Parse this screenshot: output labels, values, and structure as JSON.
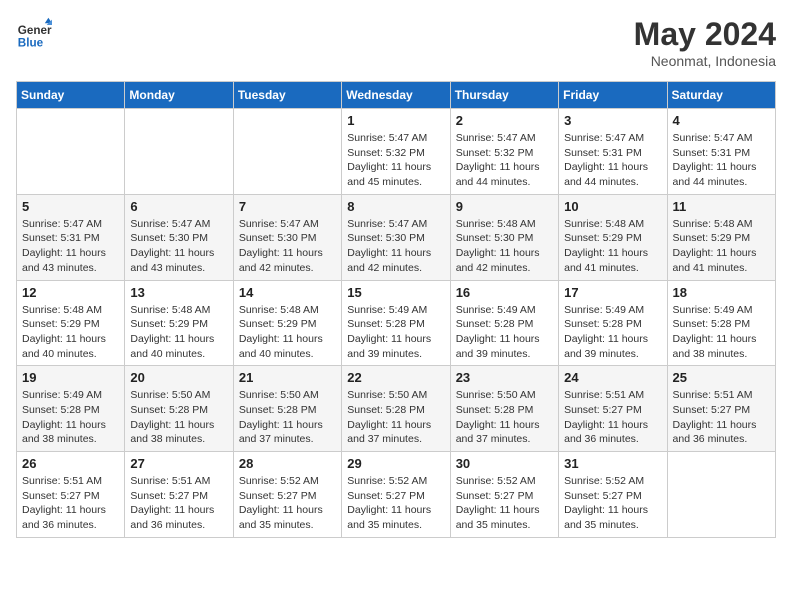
{
  "header": {
    "logo_line1": "General",
    "logo_line2": "Blue",
    "month": "May 2024",
    "location": "Neonmat, Indonesia"
  },
  "weekdays": [
    "Sunday",
    "Monday",
    "Tuesday",
    "Wednesday",
    "Thursday",
    "Friday",
    "Saturday"
  ],
  "weeks": [
    [
      {
        "day": "",
        "sunrise": "",
        "sunset": "",
        "daylight": ""
      },
      {
        "day": "",
        "sunrise": "",
        "sunset": "",
        "daylight": ""
      },
      {
        "day": "",
        "sunrise": "",
        "sunset": "",
        "daylight": ""
      },
      {
        "day": "1",
        "sunrise": "Sunrise: 5:47 AM",
        "sunset": "Sunset: 5:32 PM",
        "daylight": "Daylight: 11 hours and 45 minutes."
      },
      {
        "day": "2",
        "sunrise": "Sunrise: 5:47 AM",
        "sunset": "Sunset: 5:32 PM",
        "daylight": "Daylight: 11 hours and 44 minutes."
      },
      {
        "day": "3",
        "sunrise": "Sunrise: 5:47 AM",
        "sunset": "Sunset: 5:31 PM",
        "daylight": "Daylight: 11 hours and 44 minutes."
      },
      {
        "day": "4",
        "sunrise": "Sunrise: 5:47 AM",
        "sunset": "Sunset: 5:31 PM",
        "daylight": "Daylight: 11 hours and 44 minutes."
      }
    ],
    [
      {
        "day": "5",
        "sunrise": "Sunrise: 5:47 AM",
        "sunset": "Sunset: 5:31 PM",
        "daylight": "Daylight: 11 hours and 43 minutes."
      },
      {
        "day": "6",
        "sunrise": "Sunrise: 5:47 AM",
        "sunset": "Sunset: 5:30 PM",
        "daylight": "Daylight: 11 hours and 43 minutes."
      },
      {
        "day": "7",
        "sunrise": "Sunrise: 5:47 AM",
        "sunset": "Sunset: 5:30 PM",
        "daylight": "Daylight: 11 hours and 42 minutes."
      },
      {
        "day": "8",
        "sunrise": "Sunrise: 5:47 AM",
        "sunset": "Sunset: 5:30 PM",
        "daylight": "Daylight: 11 hours and 42 minutes."
      },
      {
        "day": "9",
        "sunrise": "Sunrise: 5:48 AM",
        "sunset": "Sunset: 5:30 PM",
        "daylight": "Daylight: 11 hours and 42 minutes."
      },
      {
        "day": "10",
        "sunrise": "Sunrise: 5:48 AM",
        "sunset": "Sunset: 5:29 PM",
        "daylight": "Daylight: 11 hours and 41 minutes."
      },
      {
        "day": "11",
        "sunrise": "Sunrise: 5:48 AM",
        "sunset": "Sunset: 5:29 PM",
        "daylight": "Daylight: 11 hours and 41 minutes."
      }
    ],
    [
      {
        "day": "12",
        "sunrise": "Sunrise: 5:48 AM",
        "sunset": "Sunset: 5:29 PM",
        "daylight": "Daylight: 11 hours and 40 minutes."
      },
      {
        "day": "13",
        "sunrise": "Sunrise: 5:48 AM",
        "sunset": "Sunset: 5:29 PM",
        "daylight": "Daylight: 11 hours and 40 minutes."
      },
      {
        "day": "14",
        "sunrise": "Sunrise: 5:48 AM",
        "sunset": "Sunset: 5:29 PM",
        "daylight": "Daylight: 11 hours and 40 minutes."
      },
      {
        "day": "15",
        "sunrise": "Sunrise: 5:49 AM",
        "sunset": "Sunset: 5:28 PM",
        "daylight": "Daylight: 11 hours and 39 minutes."
      },
      {
        "day": "16",
        "sunrise": "Sunrise: 5:49 AM",
        "sunset": "Sunset: 5:28 PM",
        "daylight": "Daylight: 11 hours and 39 minutes."
      },
      {
        "day": "17",
        "sunrise": "Sunrise: 5:49 AM",
        "sunset": "Sunset: 5:28 PM",
        "daylight": "Daylight: 11 hours and 39 minutes."
      },
      {
        "day": "18",
        "sunrise": "Sunrise: 5:49 AM",
        "sunset": "Sunset: 5:28 PM",
        "daylight": "Daylight: 11 hours and 38 minutes."
      }
    ],
    [
      {
        "day": "19",
        "sunrise": "Sunrise: 5:49 AM",
        "sunset": "Sunset: 5:28 PM",
        "daylight": "Daylight: 11 hours and 38 minutes."
      },
      {
        "day": "20",
        "sunrise": "Sunrise: 5:50 AM",
        "sunset": "Sunset: 5:28 PM",
        "daylight": "Daylight: 11 hours and 38 minutes."
      },
      {
        "day": "21",
        "sunrise": "Sunrise: 5:50 AM",
        "sunset": "Sunset: 5:28 PM",
        "daylight": "Daylight: 11 hours and 37 minutes."
      },
      {
        "day": "22",
        "sunrise": "Sunrise: 5:50 AM",
        "sunset": "Sunset: 5:28 PM",
        "daylight": "Daylight: 11 hours and 37 minutes."
      },
      {
        "day": "23",
        "sunrise": "Sunrise: 5:50 AM",
        "sunset": "Sunset: 5:28 PM",
        "daylight": "Daylight: 11 hours and 37 minutes."
      },
      {
        "day": "24",
        "sunrise": "Sunrise: 5:51 AM",
        "sunset": "Sunset: 5:27 PM",
        "daylight": "Daylight: 11 hours and 36 minutes."
      },
      {
        "day": "25",
        "sunrise": "Sunrise: 5:51 AM",
        "sunset": "Sunset: 5:27 PM",
        "daylight": "Daylight: 11 hours and 36 minutes."
      }
    ],
    [
      {
        "day": "26",
        "sunrise": "Sunrise: 5:51 AM",
        "sunset": "Sunset: 5:27 PM",
        "daylight": "Daylight: 11 hours and 36 minutes."
      },
      {
        "day": "27",
        "sunrise": "Sunrise: 5:51 AM",
        "sunset": "Sunset: 5:27 PM",
        "daylight": "Daylight: 11 hours and 36 minutes."
      },
      {
        "day": "28",
        "sunrise": "Sunrise: 5:52 AM",
        "sunset": "Sunset: 5:27 PM",
        "daylight": "Daylight: 11 hours and 35 minutes."
      },
      {
        "day": "29",
        "sunrise": "Sunrise: 5:52 AM",
        "sunset": "Sunset: 5:27 PM",
        "daylight": "Daylight: 11 hours and 35 minutes."
      },
      {
        "day": "30",
        "sunrise": "Sunrise: 5:52 AM",
        "sunset": "Sunset: 5:27 PM",
        "daylight": "Daylight: 11 hours and 35 minutes."
      },
      {
        "day": "31",
        "sunrise": "Sunrise: 5:52 AM",
        "sunset": "Sunset: 5:27 PM",
        "daylight": "Daylight: 11 hours and 35 minutes."
      },
      {
        "day": "",
        "sunrise": "",
        "sunset": "",
        "daylight": ""
      }
    ]
  ]
}
